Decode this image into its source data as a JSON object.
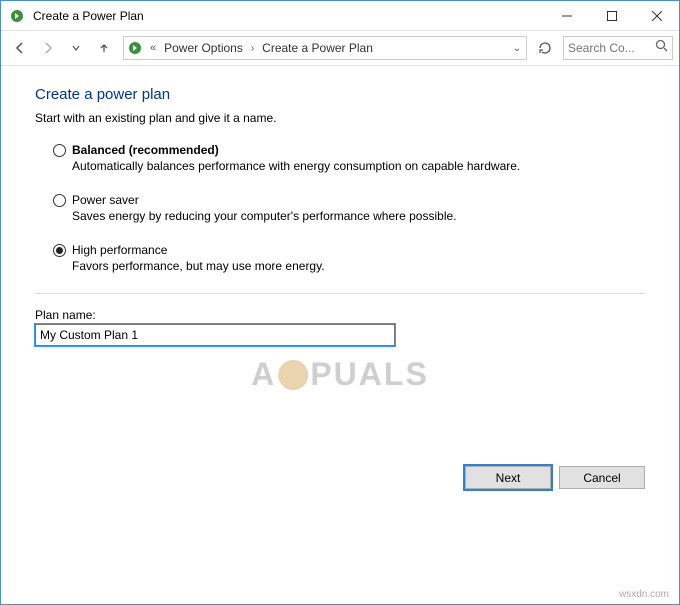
{
  "window": {
    "title": "Create a Power Plan"
  },
  "breadcrumb": {
    "seg1": "Power Options",
    "seg2": "Create a Power Plan"
  },
  "search": {
    "placeholder": "Search Co..."
  },
  "page": {
    "heading": "Create a power plan",
    "subheading": "Start with an existing plan and give it a name."
  },
  "plans": [
    {
      "name": "Balanced (recommended)",
      "desc": "Automatically balances performance with energy consumption on capable hardware.",
      "bold": true,
      "checked": false
    },
    {
      "name": "Power saver",
      "desc": "Saves energy by reducing your computer's performance where possible.",
      "bold": false,
      "checked": false
    },
    {
      "name": "High performance",
      "desc": "Favors performance, but may use more energy.",
      "bold": false,
      "checked": true
    }
  ],
  "planName": {
    "label": "Plan name:",
    "value": "My Custom Plan 1"
  },
  "buttons": {
    "next": "Next",
    "cancel": "Cancel"
  },
  "watermark": {
    "left": "A",
    "right": "PUALS",
    "site": "wsxdn.com"
  }
}
